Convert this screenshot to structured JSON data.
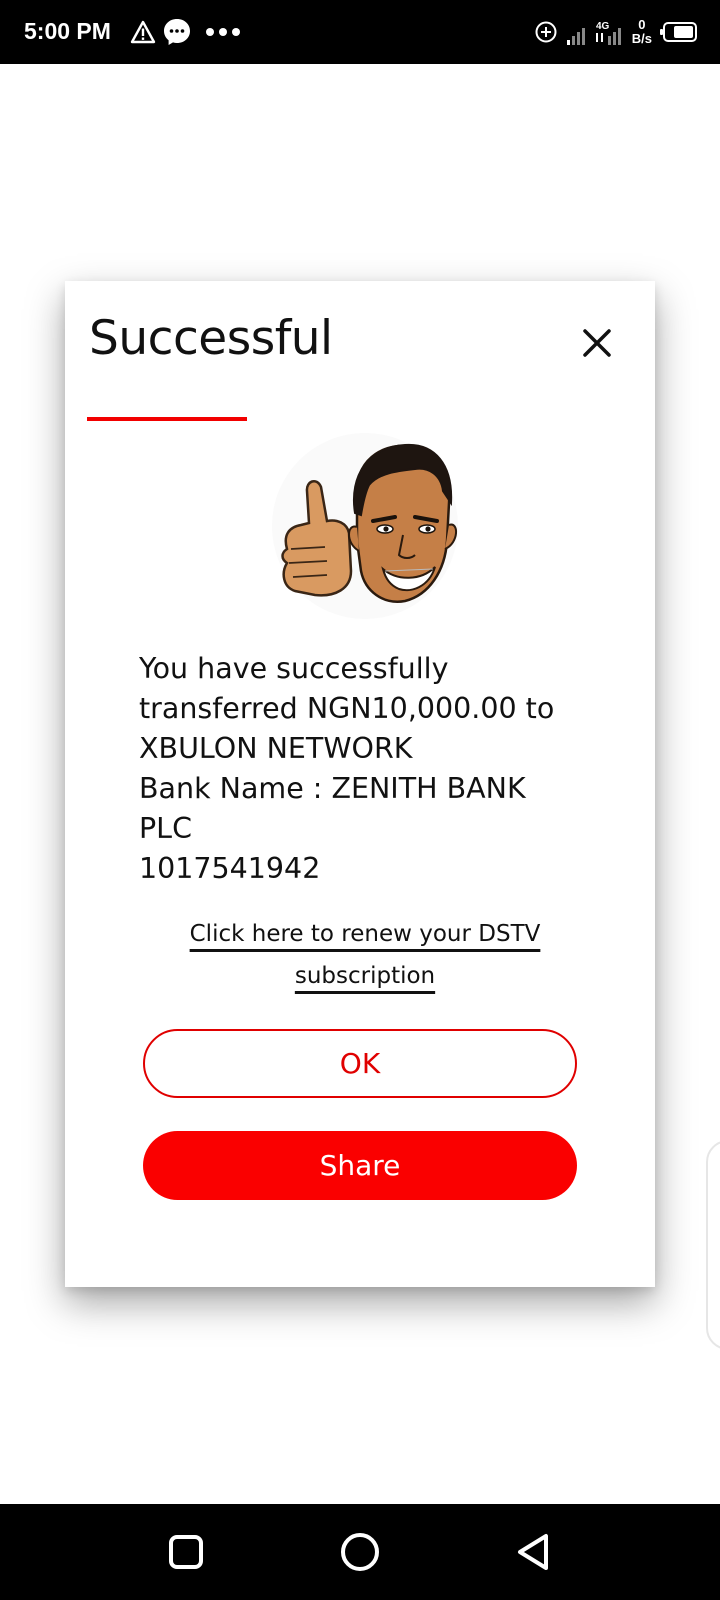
{
  "status_bar": {
    "time": "5:00 PM",
    "network_type": "4G",
    "speed_value": "0",
    "speed_unit": "B/s"
  },
  "dialog": {
    "title": "Successful",
    "message_lines": [
      "You have successfully",
      "transferred NGN10,000.00 to",
      "XBULON NETWORK",
      "Bank Name : ZENITH BANK",
      "PLC",
      "1017541942"
    ],
    "renew_link_line1": "Click here to renew your DSTV",
    "renew_link_line2": "subscription",
    "ok_label": "OK",
    "share_label": "Share"
  },
  "colors": {
    "accent": "#fa0000",
    "status_bar_bg": "#000000",
    "text": "#111111"
  },
  "icons": [
    "warning-icon",
    "messenger-icon",
    "more-dots-icon",
    "data-saver-icon",
    "signal-icon",
    "battery-icon",
    "close-icon",
    "thumbs-up-mascot",
    "square-nav-icon",
    "circle-nav-icon",
    "back-triangle-icon"
  ]
}
